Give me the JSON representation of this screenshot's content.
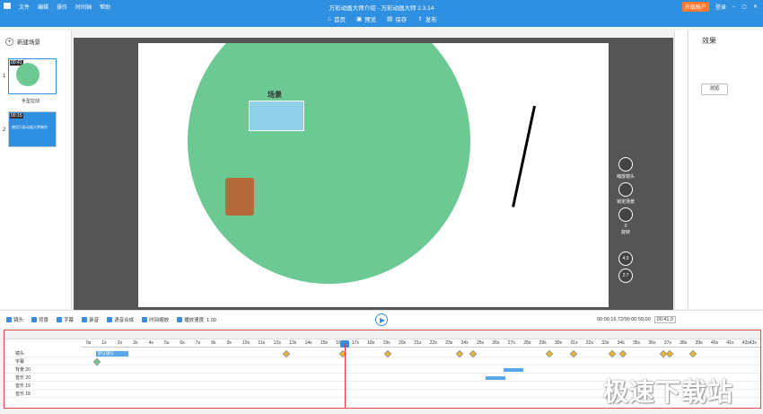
{
  "menu": {
    "items": [
      "文件",
      "编辑",
      "操作",
      "时间轴",
      "帮助"
    ]
  },
  "app_title": "万彩动画大师介绍 - 万彩动画大师 2.3.14",
  "toolbar": {
    "home": "首页",
    "preview": "预览",
    "save": "保存",
    "publish": "发布"
  },
  "window": {
    "upgrade": "升级账户",
    "login": "登录"
  },
  "left_panel": {
    "new_scene": "新建场景",
    "scenes": [
      {
        "num": "1",
        "time": "00:41",
        "name": "手型拉动"
      },
      {
        "num": "2",
        "time": "00:15",
        "name": "",
        "caption": "使用万彩动画大师制作"
      }
    ]
  },
  "canvas": {
    "scene_label": "场景",
    "tools": [
      "缩放镜头",
      "锁定场景",
      "旋转"
    ],
    "rotate_value": "0",
    "ratio_43": "4:3",
    "ratio_27": "2:7"
  },
  "props": {
    "title": "效果",
    "browse": "浏览"
  },
  "controls": {
    "items": [
      "镜头",
      "背景",
      "字幕",
      "录音",
      "语音合成",
      "时间缩放",
      "播放速度: 1.00"
    ],
    "time": "00:00:16.72/00:00:59.00",
    "duration": "00:41.0"
  },
  "timeline": {
    "ticks": [
      "0s",
      "1s",
      "2s",
      "3s",
      "4s",
      "5s",
      "6s",
      "7s",
      "8s",
      "9s",
      "10s",
      "11s",
      "12s",
      "13s",
      "14s",
      "15s",
      "16s",
      "17s",
      "18s",
      "19s",
      "20s",
      "21s",
      "22s",
      "23s",
      "24s",
      "25s",
      "26s",
      "27s",
      "28s",
      "29s",
      "30s",
      "31s",
      "32s",
      "33s",
      "34s",
      "35s",
      "36s",
      "37s",
      "38s",
      "39s",
      "40s",
      "41s",
      "42s43s"
    ],
    "tracks": [
      "镜头",
      "字幕",
      "背景 20",
      "音乐 20",
      "音乐 19",
      "音乐 18"
    ],
    "camera_label": "默认镜头"
  },
  "watermark": "极速下载站",
  "colors": {
    "accent": "#2f8fe0",
    "circle": "#6cc993",
    "playhead": "#e33333"
  }
}
